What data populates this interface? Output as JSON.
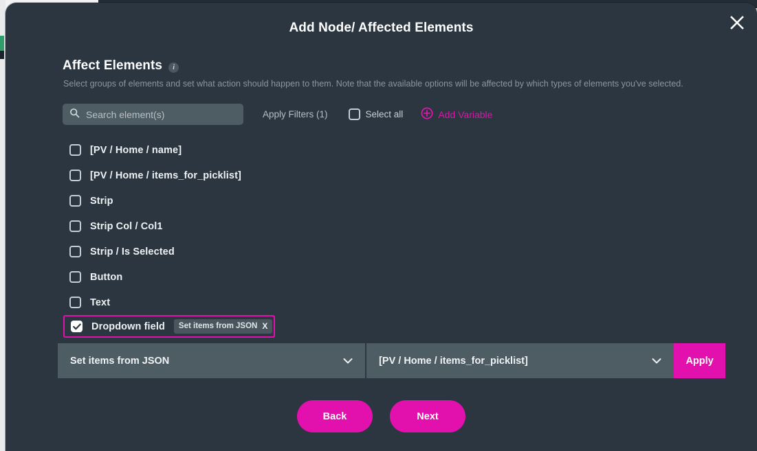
{
  "modal": {
    "title": "Add Node/ Affected Elements",
    "close_icon": "close-icon"
  },
  "section": {
    "title": "Affect Elements",
    "info_icon": "i",
    "description": "Select groups of elements and set what action should happen to them. Note that the available options will be affected by which types of elements you've selected."
  },
  "toolbar": {
    "search_placeholder": "Search element(s)",
    "search_value": "",
    "search_icon": "search-icon",
    "apply_filters_label": "Apply Filters (1)",
    "select_all_label": "Select all",
    "select_all_checked": false,
    "add_variable_label": "Add Variable",
    "add_variable_icon": "plus-circle-icon"
  },
  "elements": [
    {
      "label": "[PV / Home / name]",
      "checked": false,
      "chip": null
    },
    {
      "label": "[PV / Home / items_for_picklist]",
      "checked": false,
      "chip": null
    },
    {
      "label": "Strip",
      "checked": false,
      "chip": null
    },
    {
      "label": "Strip Col / Col1",
      "checked": false,
      "chip": null
    },
    {
      "label": "Strip / Is Selected",
      "checked": false,
      "chip": null
    },
    {
      "label": "Button",
      "checked": false,
      "chip": null
    },
    {
      "label": "Text",
      "checked": false,
      "chip": null
    },
    {
      "label": "Dropdown field",
      "checked": true,
      "chip": "Set items from JSON",
      "chip_remove": "X"
    }
  ],
  "action_bar": {
    "action_select_value": "Set items from JSON",
    "target_select_value": "[PV / Home / items_for_picklist]",
    "apply_label": "Apply",
    "caret_icon": "chevron-down-icon"
  },
  "footer": {
    "back_label": "Back",
    "next_label": "Next"
  },
  "colors": {
    "accent": "#e211ad",
    "modal_bg": "#2b3640",
    "field_bg": "#4e5c63",
    "chip_bg": "#4a565e",
    "muted_text": "#8b979f"
  }
}
